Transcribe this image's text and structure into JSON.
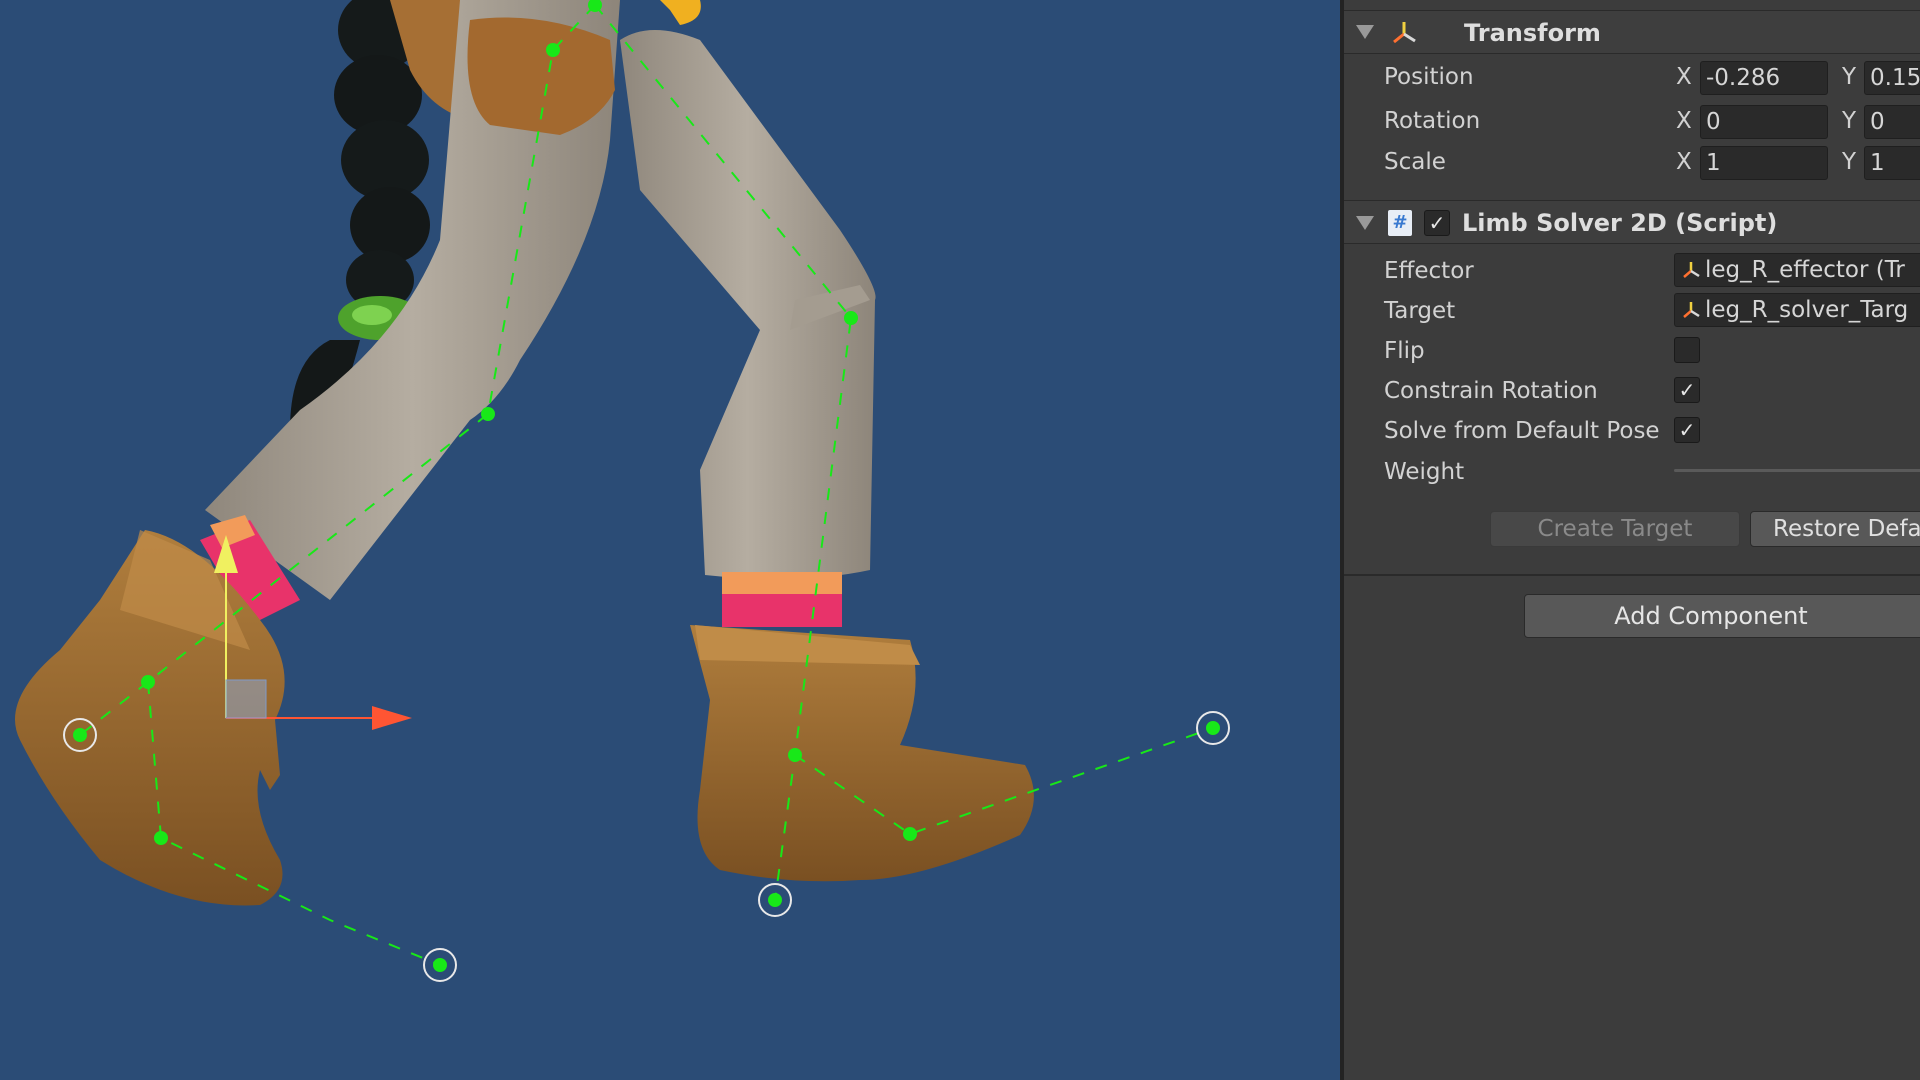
{
  "inspector": {
    "transform": {
      "title": "Transform",
      "position": {
        "label": "Position",
        "x_axis": "X",
        "x": "-0.286",
        "y_axis": "Y",
        "y": "0.15("
      },
      "rotation": {
        "label": "Rotation",
        "x_axis": "X",
        "x": "0",
        "y_axis": "Y",
        "y": "0"
      },
      "scale": {
        "label": "Scale",
        "x_axis": "X",
        "x": "1",
        "y_axis": "Y",
        "y": "1"
      }
    },
    "limb_solver": {
      "title": "Limb Solver 2D (Script)",
      "script_icon": "#",
      "enabled_check": "✓",
      "effector": {
        "label": "Effector",
        "value": "leg_R_effector (Tr"
      },
      "target": {
        "label": "Target",
        "value": "leg_R_solver_Targ"
      },
      "flip": {
        "label": "Flip",
        "checked": false
      },
      "constrain_rotation": {
        "label": "Constrain Rotation",
        "check": "✓"
      },
      "solve_default_pose": {
        "label": "Solve from Default Pose",
        "check": "✓"
      },
      "weight": {
        "label": "Weight"
      },
      "create_target_button": "Create Target",
      "restore_default_button": "Restore Defa"
    },
    "add_component_button": "Add Component"
  },
  "colors": {
    "scene_background": "#2b4c76",
    "inspector_background": "#3c3c3c",
    "bone_joint": "#18e818",
    "gizmo_x_axis": "#ff5533",
    "gizmo_y_axis": "#f0f060"
  },
  "icons": [
    "transform-axes-icon",
    "script-icon",
    "checkbox-icon",
    "foldout-arrow-icon",
    "move-gizmo-icon"
  ]
}
